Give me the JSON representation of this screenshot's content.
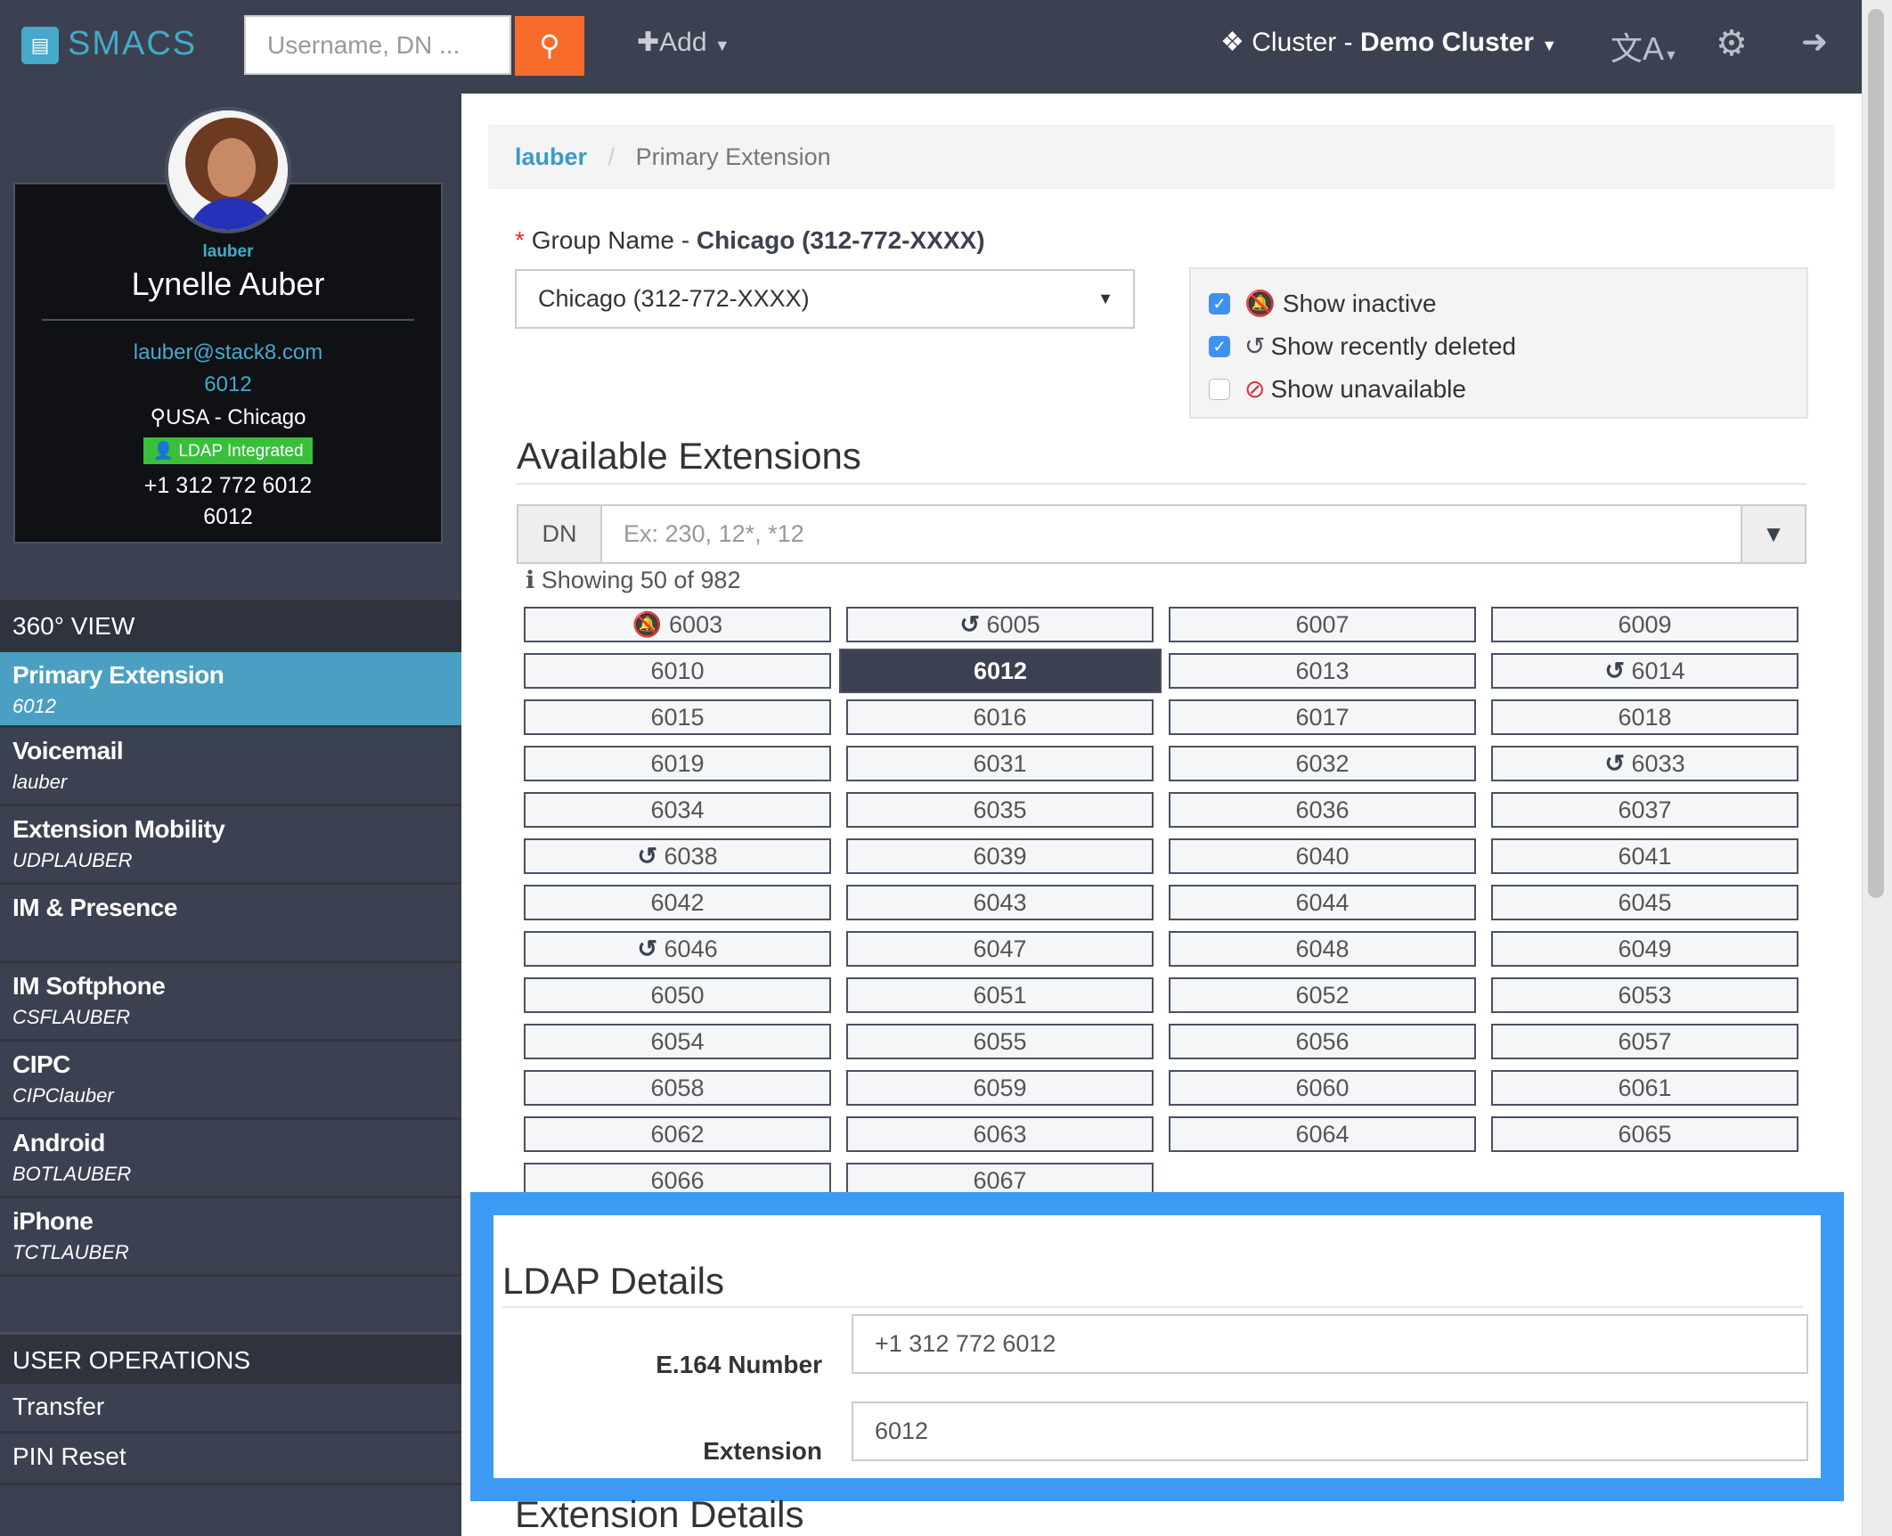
{
  "header": {
    "brand": "SMACS",
    "search_placeholder": "Username, DN ...",
    "add_label": "Add",
    "cluster_prefix": "Cluster - ",
    "cluster_name": "Demo Cluster"
  },
  "profile": {
    "username": "lauber",
    "full_name": "Lynelle Auber",
    "email": "lauber@stack8.com",
    "extension": "6012",
    "location": "USA - Chicago",
    "badge": "LDAP Integrated",
    "phone": "+1 312 772 6012",
    "extension2": "6012"
  },
  "sidebar": {
    "view_header": "360° VIEW",
    "items": [
      {
        "label": "Primary Extension",
        "sub": "6012",
        "active": true
      },
      {
        "label": "Voicemail",
        "sub": "lauber"
      },
      {
        "label": "Extension Mobility",
        "sub": "UDPLAUBER"
      },
      {
        "label": "IM & Presence",
        "sub": ""
      },
      {
        "label": "IM Softphone",
        "sub": "CSFLAUBER"
      },
      {
        "label": "CIPC",
        "sub": "CIPClauber"
      },
      {
        "label": "Android",
        "sub": "BOTLAUBER"
      },
      {
        "label": "iPhone",
        "sub": "TCTLAUBER"
      }
    ],
    "ops_header": "USER OPERATIONS",
    "ops": [
      "Transfer",
      "PIN Reset"
    ]
  },
  "breadcrumb": {
    "link": "lauber",
    "current": "Primary Extension"
  },
  "group": {
    "label_prefix": "Group Name - ",
    "label_value": "Chicago (312-772-XXXX)",
    "selected": "Chicago (312-772-XXXX)"
  },
  "filters": [
    {
      "label": "Show inactive",
      "checked": true,
      "icon": "bell-slash-icon"
    },
    {
      "label": "Show recently deleted",
      "checked": true,
      "icon": "history-icon"
    },
    {
      "label": "Show unavailable",
      "checked": false,
      "icon": "ban-icon"
    }
  ],
  "available": {
    "title": "Available Extensions",
    "dn_label": "DN",
    "dn_placeholder": "Ex: 230, 12*, *12",
    "showing": "Showing 50 of 982",
    "selected": "6012",
    "extensions": [
      {
        "n": "6003",
        "icon": "inactive"
      },
      {
        "n": "6005",
        "icon": "deleted"
      },
      {
        "n": "6007"
      },
      {
        "n": "6009"
      },
      {
        "n": "6010"
      },
      {
        "n": "6012"
      },
      {
        "n": "6013"
      },
      {
        "n": "6014",
        "icon": "deleted"
      },
      {
        "n": "6015"
      },
      {
        "n": "6016"
      },
      {
        "n": "6017"
      },
      {
        "n": "6018"
      },
      {
        "n": "6019"
      },
      {
        "n": "6031"
      },
      {
        "n": "6032"
      },
      {
        "n": "6033",
        "icon": "deleted"
      },
      {
        "n": "6034"
      },
      {
        "n": "6035"
      },
      {
        "n": "6036"
      },
      {
        "n": "6037"
      },
      {
        "n": "6038",
        "icon": "deleted"
      },
      {
        "n": "6039"
      },
      {
        "n": "6040"
      },
      {
        "n": "6041"
      },
      {
        "n": "6042"
      },
      {
        "n": "6043"
      },
      {
        "n": "6044"
      },
      {
        "n": "6045"
      },
      {
        "n": "6046",
        "icon": "deleted"
      },
      {
        "n": "6047"
      },
      {
        "n": "6048"
      },
      {
        "n": "6049"
      },
      {
        "n": "6050"
      },
      {
        "n": "6051"
      },
      {
        "n": "6052"
      },
      {
        "n": "6053"
      },
      {
        "n": "6054"
      },
      {
        "n": "6055"
      },
      {
        "n": "6056"
      },
      {
        "n": "6057"
      },
      {
        "n": "6058"
      },
      {
        "n": "6059"
      },
      {
        "n": "6060"
      },
      {
        "n": "6061"
      },
      {
        "n": "6062"
      },
      {
        "n": "6063"
      },
      {
        "n": "6064"
      },
      {
        "n": "6065"
      },
      {
        "n": "6066"
      },
      {
        "n": "6067"
      }
    ]
  },
  "ldap": {
    "title": "LDAP Details",
    "e164_label": "E.164 Number",
    "e164_value": "+1 312 772 6012",
    "ext_label": "Extension",
    "ext_value": "6012"
  },
  "extension_details_title": "Extension Details",
  "colors": {
    "header": "#3b4150",
    "accent": "#46a9c9",
    "search_button": "#f76b2b",
    "highlight": "#3d9bf5",
    "badge": "#39bf3c"
  }
}
